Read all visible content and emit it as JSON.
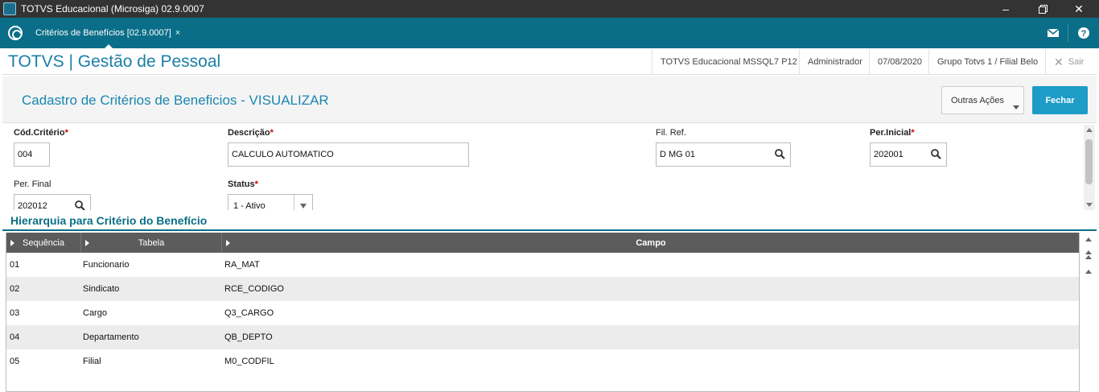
{
  "window": {
    "title": "TOTVS Educacional (Microsiga) 02.9.0007"
  },
  "tabs": [
    {
      "label": "Critérios de Benefícios [02.9.0007]",
      "close": "×"
    }
  ],
  "header": {
    "brand": "TOTVS | Gestão de Pessoal",
    "environment": "TOTVS Educacional MSSQL7 P12",
    "user": "Administrador",
    "date": "07/08/2020",
    "branch": "Grupo Totvs 1 / Filial Belo",
    "exit_label": "Sair"
  },
  "page": {
    "title": "Cadastro de Critérios de Beneficios - VISUALIZAR",
    "other_actions_label": "Outras Ações",
    "close_label": "Fechar"
  },
  "form": {
    "cod_criterio": {
      "label": "Cód.Critério",
      "required": "*",
      "value": "004"
    },
    "descricao": {
      "label": "Descrição",
      "required": "*",
      "value": "CALCULO AUTOMATICO"
    },
    "fil_ref": {
      "label": "Fil. Ref.",
      "value": "D MG 01"
    },
    "per_inicial": {
      "label": "Per.Inicial",
      "required": "*",
      "value": "202001"
    },
    "per_final": {
      "label": "Per. Final",
      "value": "202012"
    },
    "status": {
      "label": "Status",
      "required": "*",
      "value": "1 - Ativo"
    }
  },
  "section": {
    "title": "Hierarquia para Critério do Benefício"
  },
  "grid": {
    "columns": [
      "Sequência",
      "Tabela",
      "Campo"
    ],
    "rows": [
      [
        "01",
        "Funcionario",
        "RA_MAT"
      ],
      [
        "02",
        "Sindicato",
        "RCE_CODIGO"
      ],
      [
        "03",
        "Cargo",
        "Q3_CARGO"
      ],
      [
        "04",
        "Departamento",
        "QB_DEPTO"
      ],
      [
        "05",
        "Filial",
        "M0_CODFIL"
      ]
    ]
  },
  "colors": {
    "accent": "#0b6e88",
    "brand": "#1a7fa6",
    "primary_button": "#1e9cc8",
    "required": "#cc0000"
  },
  "icons": [
    "app-icon",
    "minimize-icon",
    "restore-icon",
    "close-icon",
    "totvs-logo-icon",
    "mail-icon",
    "help-icon",
    "search-icon",
    "chevron-down-icon",
    "sort-arrow-icon"
  ]
}
